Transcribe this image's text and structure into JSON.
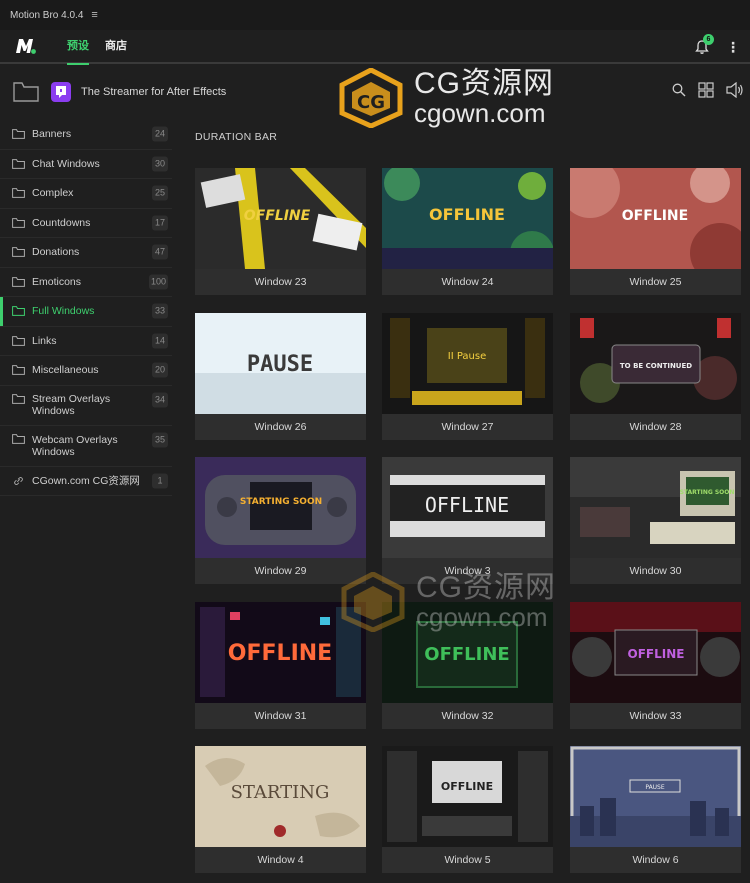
{
  "app": {
    "title": "Motion Bro 4.0.4"
  },
  "nav": {
    "tabs": [
      {
        "label": "预设"
      },
      {
        "label": "商店"
      }
    ],
    "notification_count": "6"
  },
  "project": {
    "title": "The Streamer for After Effects"
  },
  "watermark": {
    "line1": "CG资源网",
    "line2": "cgown.com"
  },
  "sidebar": {
    "items": [
      {
        "label": "Banners",
        "count": "24"
      },
      {
        "label": "Chat Windows",
        "count": "30"
      },
      {
        "label": "Complex",
        "count": "25"
      },
      {
        "label": "Countdowns",
        "count": "17"
      },
      {
        "label": "Donations",
        "count": "47"
      },
      {
        "label": "Emoticons",
        "count": "100"
      },
      {
        "label": "Full Windows",
        "count": "33"
      },
      {
        "label": "Links",
        "count": "14"
      },
      {
        "label": "Miscellaneous",
        "count": "20"
      },
      {
        "label": "Stream Overlays Windows",
        "count": "34"
      },
      {
        "label": "Webcam Overlays Windows",
        "count": "35"
      },
      {
        "label": "CGown.com CG资源网",
        "count": "1"
      }
    ]
  },
  "main": {
    "section_title": "DURATION BAR",
    "cards": [
      {
        "label": "Window 23",
        "thumb_text": "OFFLINE"
      },
      {
        "label": "Window 24",
        "thumb_text": "OFFLINE"
      },
      {
        "label": "Window 25",
        "thumb_text": "OFFLINE"
      },
      {
        "label": "Window 26",
        "thumb_text": "PAUSE"
      },
      {
        "label": "Window 27",
        "thumb_text": "II Pause"
      },
      {
        "label": "Window 28",
        "thumb_text": "TO BE CONTINUED"
      },
      {
        "label": "Window 29",
        "thumb_text": "STARTING SOON"
      },
      {
        "label": "Window 3",
        "thumb_text": "OFFLINE"
      },
      {
        "label": "Window 30",
        "thumb_text": "STARTING SOON"
      },
      {
        "label": "Window 31",
        "thumb_text": "OFFLINE"
      },
      {
        "label": "Window 32",
        "thumb_text": "OFFLINE"
      },
      {
        "label": "Window 33",
        "thumb_text": "OFFLINE"
      },
      {
        "label": "Window 4",
        "thumb_text": "STARTING"
      },
      {
        "label": "Window 5",
        "thumb_text": "OFFLINE"
      },
      {
        "label": "Window 6",
        "thumb_text": "PAUSE"
      }
    ]
  },
  "colors": {
    "accent": "#3ecf6e",
    "background": "#1f1f1f",
    "card": "#2e2e2e"
  }
}
